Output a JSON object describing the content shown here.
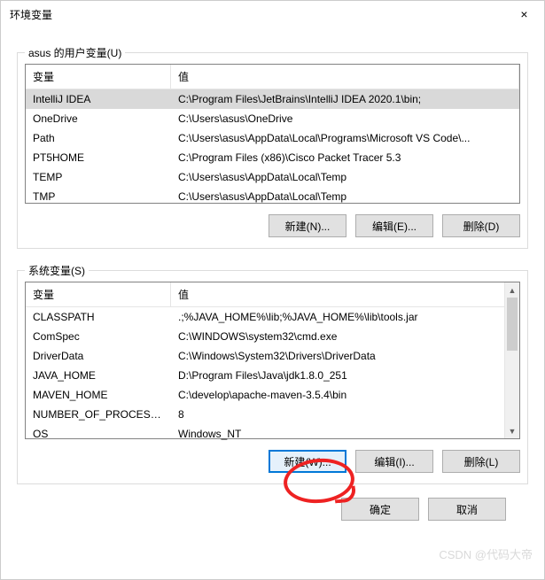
{
  "window": {
    "title": "环境变量",
    "close": "×"
  },
  "user_section": {
    "label": "asus 的用户变量(U)",
    "headers": {
      "var": "变量",
      "val": "值"
    },
    "rows": [
      {
        "var": "IntelliJ IDEA",
        "val": "C:\\Program Files\\JetBrains\\IntelliJ IDEA 2020.1\\bin;",
        "selected": true
      },
      {
        "var": "OneDrive",
        "val": "C:\\Users\\asus\\OneDrive"
      },
      {
        "var": "Path",
        "val": "C:\\Users\\asus\\AppData\\Local\\Programs\\Microsoft VS Code\\..."
      },
      {
        "var": "PT5HOME",
        "val": "C:\\Program Files (x86)\\Cisco Packet Tracer 5.3"
      },
      {
        "var": "TEMP",
        "val": "C:\\Users\\asus\\AppData\\Local\\Temp"
      },
      {
        "var": "TMP",
        "val": "C:\\Users\\asus\\AppData\\Local\\Temp"
      }
    ],
    "buttons": {
      "new": "新建(N)...",
      "edit": "编辑(E)...",
      "delete": "删除(D)"
    }
  },
  "system_section": {
    "label": "系统变量(S)",
    "headers": {
      "var": "变量",
      "val": "值"
    },
    "rows": [
      {
        "var": "CLASSPATH",
        "val": ".;%JAVA_HOME%\\lib;%JAVA_HOME%\\lib\\tools.jar"
      },
      {
        "var": "ComSpec",
        "val": "C:\\WINDOWS\\system32\\cmd.exe"
      },
      {
        "var": "DriverData",
        "val": "C:\\Windows\\System32\\Drivers\\DriverData"
      },
      {
        "var": "JAVA_HOME",
        "val": "D:\\Program Files\\Java\\jdk1.8.0_251"
      },
      {
        "var": "MAVEN_HOME",
        "val": "C:\\develop\\apache-maven-3.5.4\\bin"
      },
      {
        "var": "NUMBER_OF_PROCESSORS",
        "val": "8"
      },
      {
        "var": "OS",
        "val": "Windows_NT"
      }
    ],
    "buttons": {
      "new": "新建(W)...",
      "edit": "编辑(I)...",
      "delete": "删除(L)"
    }
  },
  "footer": {
    "ok": "确定",
    "cancel": "取消"
  },
  "watermark": "CSDN @代码大帝"
}
